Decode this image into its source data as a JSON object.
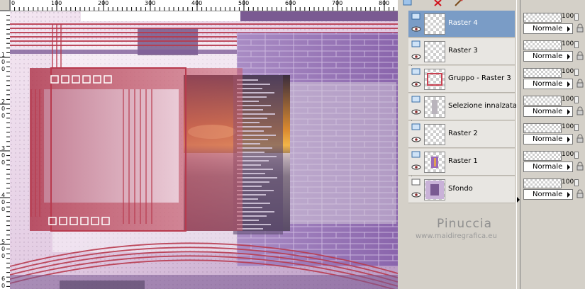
{
  "ruler": {
    "top_labels": [
      "0",
      "100",
      "200",
      "300",
      "400",
      "500",
      "600",
      "700",
      "800"
    ],
    "left_labels": [
      "1",
      "0",
      "0",
      "2",
      "0",
      "0",
      "3",
      "0",
      "0",
      "4",
      "0",
      "0",
      "5",
      "0",
      "0",
      "6",
      "0"
    ]
  },
  "layers": [
    {
      "name": "Raster 4",
      "selected": true,
      "opacity": "100",
      "blend": "Normale"
    },
    {
      "name": "Raster 3",
      "selected": false,
      "opacity": "100",
      "blend": "Normale"
    },
    {
      "name": "Gruppo - Raster 3",
      "selected": false,
      "opacity": "100",
      "blend": "Normale"
    },
    {
      "name": "Selezione innalzata",
      "selected": false,
      "opacity": "100",
      "blend": "Normale"
    },
    {
      "name": "Raster 2",
      "selected": false,
      "opacity": "100",
      "blend": "Normale"
    },
    {
      "name": "Raster 1",
      "selected": false,
      "opacity": "100",
      "blend": "Normale"
    },
    {
      "name": "Sfondo",
      "selected": false,
      "opacity": "100",
      "blend": "Normale"
    }
  ],
  "watermark": {
    "name": "Pinuccia",
    "url": "www.maidiregrafica.eu"
  },
  "colors": {
    "selected_row": "#7a9cc6",
    "accent_red": "#b83a4e",
    "purple": "#8e6aa8"
  },
  "icons": {
    "toolbar": [
      "new-layer-icon",
      "delete-layer-icon",
      "brush-icon"
    ],
    "layer_row": [
      "raster-layer-icon",
      "eye-icon",
      "lock-icon"
    ]
  }
}
